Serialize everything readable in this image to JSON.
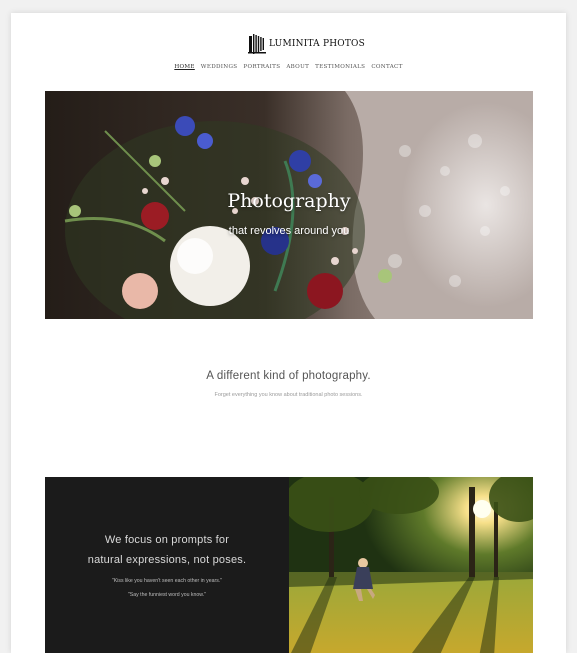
{
  "brand": {
    "name": "Luminita Photos",
    "logo_icon": "camera-bellows-icon"
  },
  "nav": {
    "items": [
      {
        "label": "HOME",
        "active": true
      },
      {
        "label": "WEDDINGS",
        "active": false
      },
      {
        "label": "PORTRAITS",
        "active": false
      },
      {
        "label": "ABOUT",
        "active": false
      },
      {
        "label": "TESTIMONIALS",
        "active": false
      },
      {
        "label": "CONTACT",
        "active": false
      }
    ]
  },
  "hero": {
    "title": "Photography",
    "subtitle": "that revolves around you"
  },
  "intro": {
    "title": "A different kind of photography.",
    "subtitle": "Forget everything you know about traditional photo sessions."
  },
  "focus": {
    "line1": "We focus on prompts for",
    "line2": "natural expressions, not poses.",
    "quotes": [
      "\"Kiss like you haven't seen each other in years.\"",
      "\"Say the funniest word you know.\""
    ]
  },
  "colors": {
    "page_bg": "#ffffff",
    "dark_panel": "#1b1b1b",
    "muted_text": "#9a9a9a"
  }
}
